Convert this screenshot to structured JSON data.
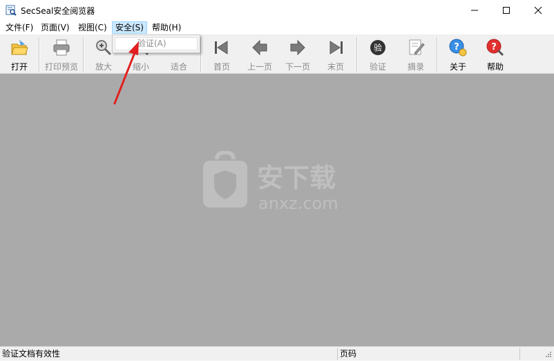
{
  "window": {
    "title": "SecSeal安全阅览器"
  },
  "menu": {
    "items": [
      {
        "label": "文件(F)"
      },
      {
        "label": "页面(V)"
      },
      {
        "label": "视图(C)"
      },
      {
        "label": "安全(S)"
      },
      {
        "label": "帮助(H)"
      }
    ],
    "active_index": 3
  },
  "dropdown": {
    "items": [
      {
        "label": "验证(A)",
        "enabled": false
      }
    ]
  },
  "toolbar": {
    "buttons": [
      {
        "label": "打开",
        "icon": "open-icon",
        "enabled": true
      },
      {
        "label": "打印预览",
        "icon": "print-preview-icon",
        "enabled": false
      },
      {
        "label": "放大",
        "icon": "zoom-in-icon",
        "enabled": false
      },
      {
        "label": "缩小",
        "icon": "zoom-out-icon",
        "enabled": false
      },
      {
        "label": "适合",
        "icon": "fit-icon",
        "enabled": false
      },
      {
        "label": "首页",
        "icon": "first-page-icon",
        "enabled": false
      },
      {
        "label": "上一页",
        "icon": "prev-page-icon",
        "enabled": false
      },
      {
        "label": "下一页",
        "icon": "next-page-icon",
        "enabled": false
      },
      {
        "label": "末页",
        "icon": "last-page-icon",
        "enabled": false
      },
      {
        "label": "验证",
        "icon": "verify-icon",
        "enabled": false
      },
      {
        "label": "摘录",
        "icon": "excerpt-icon",
        "enabled": false
      },
      {
        "label": "关于",
        "icon": "about-icon",
        "enabled": true
      },
      {
        "label": "帮助",
        "icon": "help-icon",
        "enabled": true
      }
    ]
  },
  "status": {
    "message": "验证文档有效性",
    "page_label": "页码"
  },
  "colors": {
    "document_background": "#abaaab",
    "arrow": "#e02020",
    "menu_highlight": "#cce8ff"
  }
}
